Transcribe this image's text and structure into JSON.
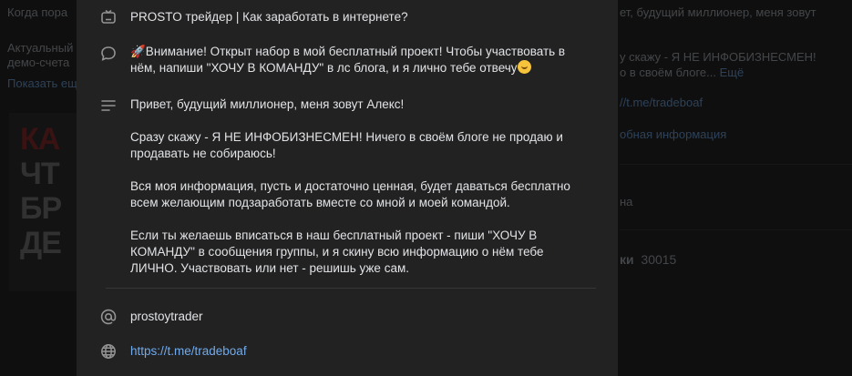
{
  "background": {
    "left_line1": "Когда пора",
    "left_line2": "Актуальный",
    "left_line3": "демо-счета",
    "left_link": "Показать ещ",
    "right_line1": "ет, будущий миллионер, меня зовут",
    "right_line2": "у скажу - Я НЕ ИНФОБИЗНЕСМЕН!",
    "right_line3": "о в своём блоге...",
    "right_more": "Ещё",
    "right_link": "//t.me/tradeboaf",
    "right_info": "обная информация",
    "right_na": "на",
    "right_count_label": "ки",
    "right_count": "30015",
    "poster_lines": [
      "КА",
      "ЧТ",
      "БР",
      "ДЕ"
    ]
  },
  "panel": {
    "title": "PROSTO трейдер | Как заработать в интернете?",
    "announcement": "🚀Внимание! Открыт набор в мой бесплатный проект! Чтобы участвовать в нём, напиши \"ХОЧУ В КОМАНДУ\" в лс блога, и я лично тебе отвечу",
    "description": [
      "Привет, будущий миллионер, меня зовут Алекс!",
      "Сразу скажу - Я НЕ ИНФОБИЗНЕСМЕН! Ничего в своём блоге не продаю и продавать не собираюсь!",
      "Вся моя информация, пусть и достаточно ценная, будет даваться бесплатно всем желающим подзаработать вместе со мной и моей командой.",
      "Если ты желаешь вписаться в наш бесплатный проект - пиши \"ХОЧУ В КОМАНДУ\" в сообщения группы, и я скину всю информацию о нём тебе ЛИЧНО. Участвовать или нет - решишь уже сам."
    ],
    "username": "prostoytrader",
    "website": "https://t.me/tradeboaf",
    "icons": {
      "title": "tv-icon",
      "announcement": "chat-bubble-icon",
      "description": "text-lines-icon",
      "username": "at-sign-icon",
      "website": "globe-icon"
    }
  },
  "colors": {
    "panel_bg": "#222222",
    "text": "#e1e3e6",
    "icon": "#939393",
    "link": "#71aaeb"
  }
}
